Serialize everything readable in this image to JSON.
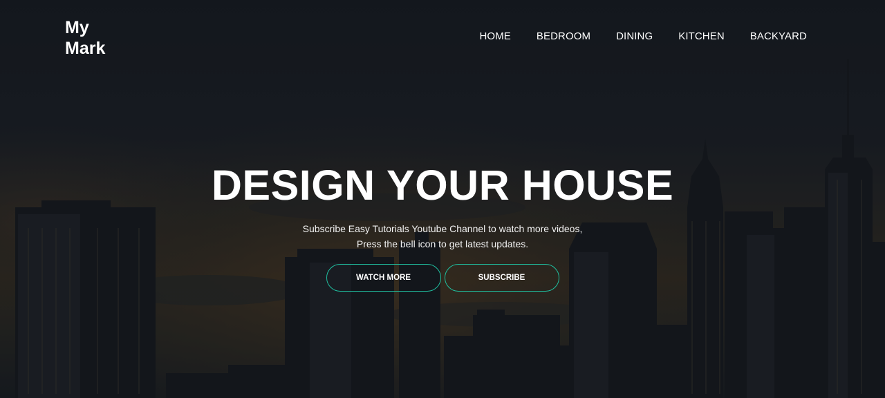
{
  "brand": {
    "line1": "My",
    "line2": "Mark"
  },
  "nav": {
    "items": [
      {
        "label": "HOME"
      },
      {
        "label": "BEDROOM"
      },
      {
        "label": "DINING"
      },
      {
        "label": "KITCHEN"
      },
      {
        "label": "BACKYARD"
      }
    ]
  },
  "hero": {
    "title": "DESIGN YOUR HOUSE",
    "subtitle_line1": "Subscribe Easy Tutorials Youtube Channel to watch more videos,",
    "subtitle_line2": "Press the bell icon to get latest updates.",
    "button_watch": "WATCH MORE",
    "button_subscribe": "SUBSCRIBE"
  },
  "colors": {
    "accent": "#1fbfa0",
    "sky_dark": "#1b1f26",
    "text": "#ffffff"
  }
}
